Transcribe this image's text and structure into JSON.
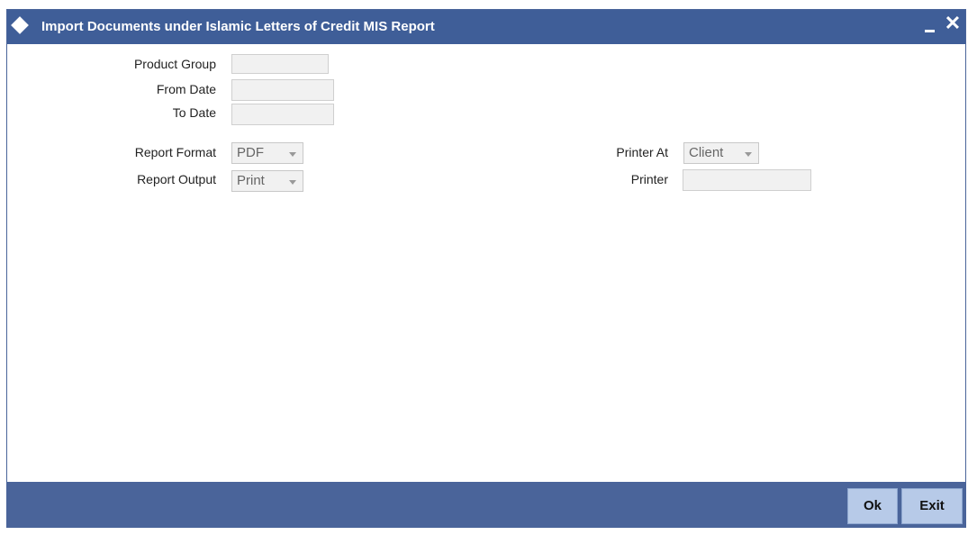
{
  "window": {
    "title": "Import Documents under Islamic Letters of Credit MIS Report",
    "close_glyph": "✕"
  },
  "form": {
    "product_group_label": "Product Group",
    "product_group_value": "",
    "from_date_label": "From Date",
    "from_date_value": "",
    "to_date_label": "To Date",
    "to_date_value": "",
    "report_format_label": "Report Format",
    "report_format_value": "PDF",
    "report_output_label": "Report Output",
    "report_output_value": "Print",
    "printer_at_label": "Printer At",
    "printer_at_value": "Client",
    "printer_label": "Printer",
    "printer_value": ""
  },
  "footer": {
    "ok_label": "Ok",
    "exit_label": "Exit"
  },
  "colors": {
    "titlebar": "#3f5e98",
    "footer": "#4a649a",
    "button": "#b7cae8",
    "field": "#f1f1f1"
  },
  "icons": {
    "title": "diamond-icon",
    "minimize": "minimize-icon",
    "close": "close-icon",
    "dropdown": "chevron-down-icon"
  }
}
